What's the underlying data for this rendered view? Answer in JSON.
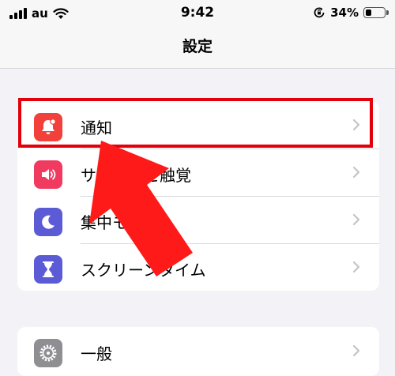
{
  "status_bar": {
    "carrier": "au",
    "time": "9:42",
    "battery_percent": "34%",
    "battery_level": 0.34
  },
  "nav": {
    "title": "設定"
  },
  "groups": [
    {
      "items": [
        {
          "label": "通知",
          "icon": "bell-icon",
          "icon_color": "#f2403a"
        },
        {
          "label": "サウンドと触覚",
          "icon": "speaker-icon",
          "icon_color": "#f03a5f"
        },
        {
          "label": "集中モード",
          "icon": "moon-icon",
          "icon_color": "#5b5bd6"
        },
        {
          "label": "スクリーンタイム",
          "icon": "hourglass-icon",
          "icon_color": "#5b5bd6"
        }
      ]
    },
    {
      "items": [
        {
          "label": "一般",
          "icon": "gear-icon",
          "icon_color": "#8e8e93"
        }
      ]
    }
  ],
  "annotation": {
    "highlight_color": "#e3000b",
    "arrow_color": "#ff0000"
  }
}
